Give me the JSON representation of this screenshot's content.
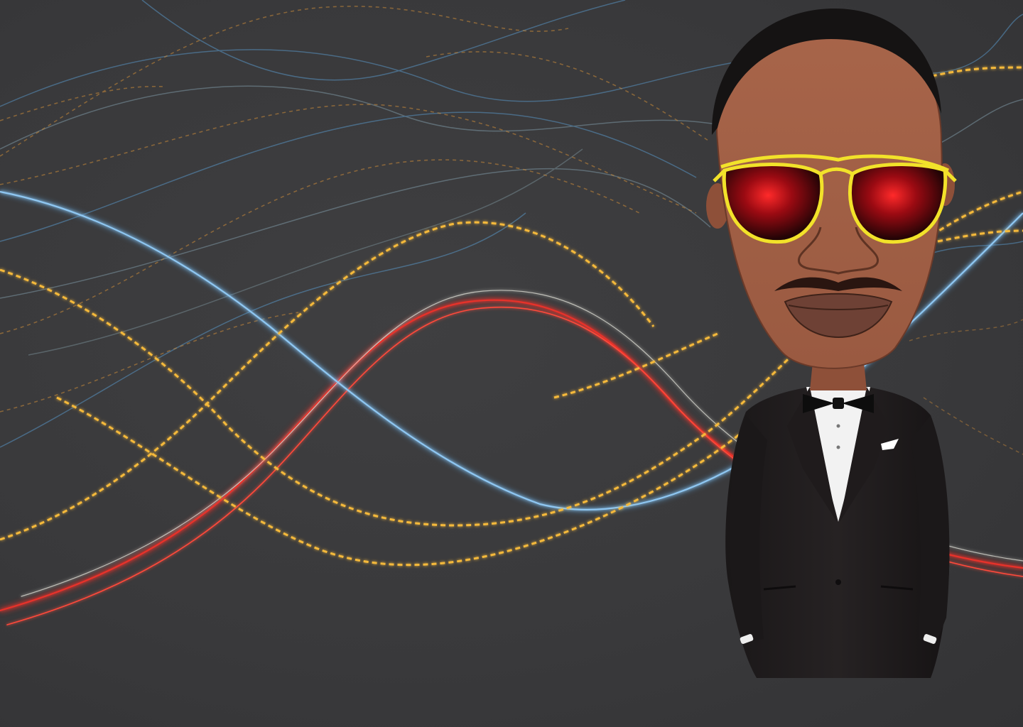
{
  "scene": {
    "background_color": "#3a3a3c",
    "background_style": "long-exposure light trails",
    "trail_colors": [
      "#f5b93a",
      "#e8312a",
      "#5ea7e0",
      "#d8d8d0",
      "#c98a3a"
    ],
    "character": {
      "type": "cartoon bobblehead man",
      "skin_color": "#a8654a",
      "hair_color": "#151313",
      "sunglasses_frame_color": "#f2e22a",
      "sunglasses_lens_color": "#b3121c",
      "suit_color": "#1d1a1b",
      "shirt_color": "#f2f2f2",
      "bowtie_color": "#0d0d0d",
      "pocket_square_color": "#ffffff"
    }
  }
}
